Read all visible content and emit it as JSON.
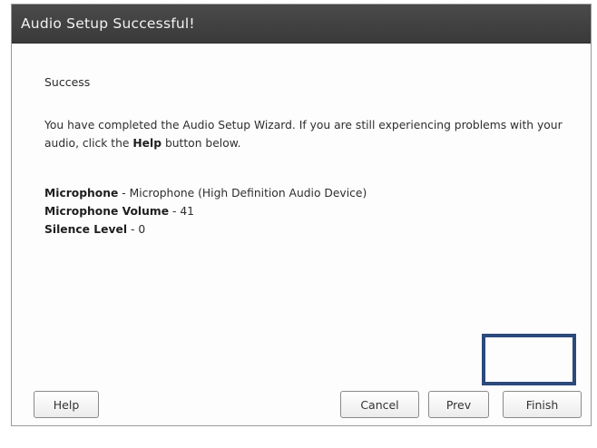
{
  "dialog": {
    "title": "Audio Setup Successful!"
  },
  "content": {
    "heading": "Success",
    "message": {
      "part1": "You have completed the Audio Setup Wizard. If you are still experiencing problems with your audio, click the ",
      "help_word": "Help",
      "part2": " button below."
    },
    "info": [
      {
        "key": "Microphone",
        "sep": " - ",
        "value": "Microphone (High Definition Audio Device)"
      },
      {
        "key": "Microphone Volume",
        "sep": " - ",
        "value": "41"
      },
      {
        "key": "Silence Level",
        "sep": " - ",
        "value": "0"
      }
    ]
  },
  "buttons": {
    "help": "Help",
    "cancel": "Cancel",
    "prev": "Prev",
    "finish": "Finish"
  },
  "colors": {
    "titlebar": "#3f3f3f",
    "highlight_border": "#2c4a7c"
  }
}
